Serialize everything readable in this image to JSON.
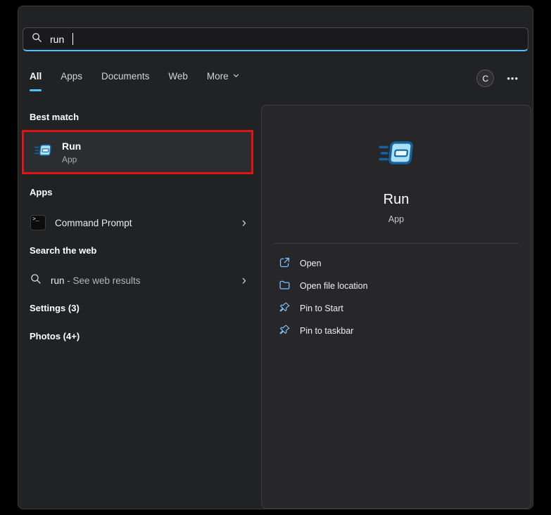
{
  "colors": {
    "accent": "#4cc2ff",
    "annotation_red": "#e01414",
    "action_icon_blue": "#7ac1ff"
  },
  "search": {
    "value": "run"
  },
  "tabs": [
    {
      "label": "All",
      "active": true
    },
    {
      "label": "Apps",
      "active": false
    },
    {
      "label": "Documents",
      "active": false
    },
    {
      "label": "Web",
      "active": false
    },
    {
      "label": "More",
      "active": false
    }
  ],
  "topbar": {
    "avatar_initial": "C",
    "more_label": "•••"
  },
  "sections": {
    "best_match_header": "Best match",
    "apps_header": "Apps",
    "web_header": "Search the web",
    "settings_header": "Settings (3)",
    "photos_header": "Photos (4+)"
  },
  "best_match": {
    "title": "Run",
    "subtitle": "App"
  },
  "apps": [
    {
      "label": "Command Prompt"
    }
  ],
  "web_results": [
    {
      "query": "run",
      "suffix": " - See web results"
    }
  ],
  "icons": {
    "cmd_glyph": ">_"
  },
  "preview": {
    "title": "Run",
    "subtitle": "App",
    "actions": [
      {
        "label": "Open"
      },
      {
        "label": "Open file location"
      },
      {
        "label": "Pin to Start"
      },
      {
        "label": "Pin to taskbar"
      }
    ]
  }
}
